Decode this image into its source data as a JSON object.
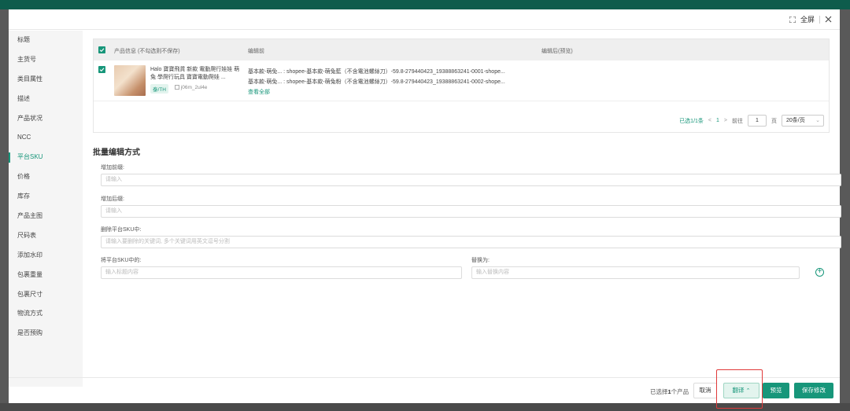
{
  "header": {
    "fullscreen_label": "全屏"
  },
  "sidebar": {
    "items": [
      {
        "label": "标题",
        "active": false
      },
      {
        "label": "主货号",
        "active": false
      },
      {
        "label": "类目属性",
        "active": false
      },
      {
        "label": "描述",
        "active": false
      },
      {
        "label": "产品状况",
        "active": false
      },
      {
        "label": "NCC",
        "active": false
      },
      {
        "label": "平台SKU",
        "active": true
      },
      {
        "label": "价格",
        "active": false
      },
      {
        "label": "库存",
        "active": false
      },
      {
        "label": "产品主图",
        "active": false
      },
      {
        "label": "尺码表",
        "active": false
      },
      {
        "label": "添加水印",
        "active": false
      },
      {
        "label": "包裹重量",
        "active": false
      },
      {
        "label": "包裹尺寸",
        "active": false
      },
      {
        "label": "物流方式",
        "active": false
      },
      {
        "label": "是否预购",
        "active": false
      }
    ]
  },
  "table": {
    "columns": {
      "product_info": "产品信息 (不勾选则不保存)",
      "before": "编辑前",
      "after": "编辑后(预览)"
    },
    "row": {
      "product_name": "Halo 寶寶飛貨 新款 電動爬行娃娃 萌兔 學爬行玩具 寶寶電動爬娃 ...",
      "site_tag": "泰/TH",
      "sku_id": "j06m_2ul4e",
      "before_lines": [
        "基本款-萌免... : shopee-基本款-萌兔藍（不含電池螺絲刀）-59.8-279440423_19388863241-0001-shope...",
        "基本款-萌免... : shopee-基本款-萌兔粉（不含電池螺絲刀）-59.8-279440423_19388863241-0002-shope..."
      ],
      "view_all": "查看全部"
    }
  },
  "pager": {
    "selected": "已选1/1条",
    "prev": "<",
    "current_page": "1",
    "next": ">",
    "goto_label": "前往",
    "goto_value": "1",
    "page_unit": "页",
    "page_size": "20条/页"
  },
  "batch": {
    "title": "批量编辑方式",
    "prefix_label": "增加前缀:",
    "prefix_placeholder": "请输入",
    "suffix_label": "增加后缀:",
    "suffix_placeholder": "请输入",
    "delete_label": "删除平台SKU中:",
    "delete_placeholder": "请输入要删除的关键词, 多个关键词用英文逗号分割",
    "replace_from_label": "将平台SKU中的:",
    "replace_from_placeholder": "输入标题内容",
    "replace_to_label": "替换为:",
    "replace_to_placeholder": "输入替换内容"
  },
  "footer": {
    "selected_prefix": "已选择",
    "selected_count": "1",
    "selected_suffix": "个产品",
    "cancel": "取消",
    "translate": "翻译",
    "preview": "预览",
    "save": "保存修改"
  },
  "colors": {
    "accent": "#17967a",
    "highlight": "#e03a3a"
  }
}
